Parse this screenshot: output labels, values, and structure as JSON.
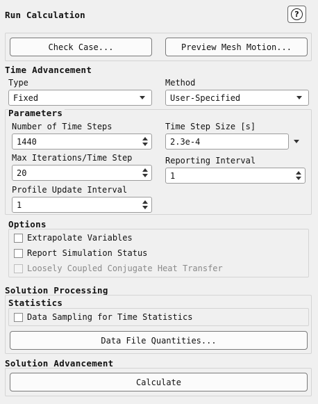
{
  "header": {
    "title": "Run Calculation",
    "help_icon": "question-circle-icon",
    "help_glyph": "?"
  },
  "top_buttons": {
    "check_case": "Check Case...",
    "preview_mesh": "Preview Mesh Motion..."
  },
  "time_advancement": {
    "heading": "Time Advancement",
    "type_label": "Type",
    "type_value": "Fixed",
    "method_label": "Method",
    "method_value": "User-Specified"
  },
  "parameters": {
    "heading": "Parameters",
    "num_steps_label": "Number of Time Steps",
    "num_steps_value": "1440",
    "step_size_label": "Time Step Size [s]",
    "step_size_value": "2.3e-4",
    "max_iter_label": "Max Iterations/Time Step",
    "max_iter_value": "20",
    "reporting_label": "Reporting Interval",
    "reporting_value": "1",
    "profile_label": "Profile Update Interval",
    "profile_value": "1"
  },
  "options": {
    "heading": "Options",
    "extrapolate": {
      "label": "Extrapolate Variables",
      "checked": false,
      "enabled": true
    },
    "report_status": {
      "label": "Report Simulation Status",
      "checked": false,
      "enabled": true
    },
    "loosely_coupled": {
      "label": "Loosely Coupled Conjugate Heat Transfer",
      "checked": false,
      "enabled": false
    }
  },
  "solution_processing": {
    "heading": "Solution Processing",
    "statistics_heading": "Statistics",
    "data_sampling": {
      "label": "Data Sampling for Time Statistics",
      "checked": false
    },
    "data_file_button": "Data File Quantities..."
  },
  "solution_advancement": {
    "heading": "Solution Advancement",
    "calculate_button": "Calculate"
  }
}
